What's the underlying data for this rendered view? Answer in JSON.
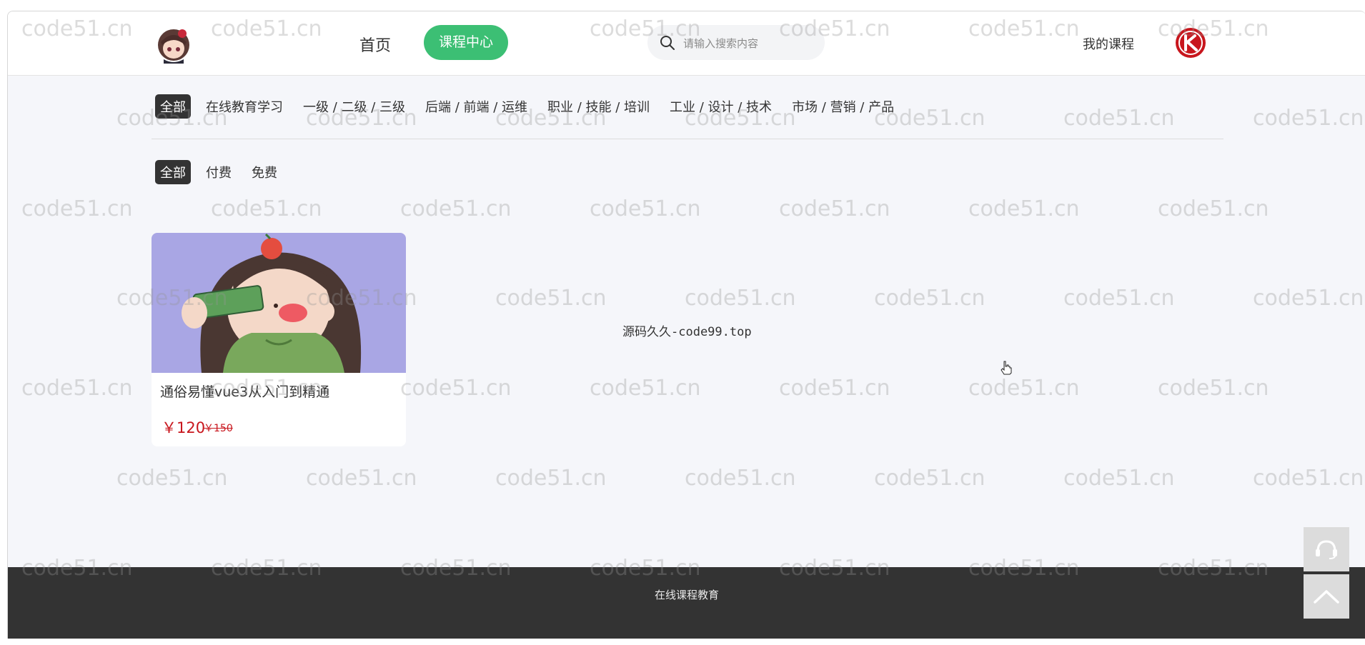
{
  "header": {
    "home_label": "首页",
    "course_center_label": "课程中心",
    "search_placeholder": "请输入搜索内容",
    "my_courses_label": "我的课程"
  },
  "category_filters": [
    {
      "label": "全部",
      "active": true
    },
    {
      "label": "在线教育学习",
      "active": false
    },
    {
      "label": "一级 / 二级 / 三级",
      "active": false
    },
    {
      "label": "后端 / 前端 / 运维",
      "active": false
    },
    {
      "label": "职业 / 技能 / 培训",
      "active": false
    },
    {
      "label": "工业 / 设计 / 技术",
      "active": false
    },
    {
      "label": "市场 / 营销 / 产品",
      "active": false
    }
  ],
  "price_filters": [
    {
      "label": "全部",
      "active": true
    },
    {
      "label": "付费",
      "active": false
    },
    {
      "label": "免费",
      "active": false
    }
  ],
  "courses": [
    {
      "title": "通俗易懂vue3从入门到精通",
      "price": "￥120",
      "original_price": "￥150"
    }
  ],
  "center_text": "源码久久-code99.top",
  "footer": {
    "text": "在线课程教育"
  },
  "watermark": "code51.cn",
  "colors": {
    "accent": "#3cbf74",
    "price": "#c8161d",
    "footer": "#333333",
    "active_chip": "#333333"
  }
}
